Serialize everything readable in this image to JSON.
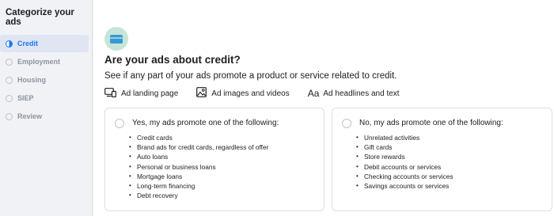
{
  "sidebar": {
    "title": "Categorize your ads",
    "steps": [
      {
        "label": "Credit",
        "active": true
      },
      {
        "label": "Employment",
        "active": false
      },
      {
        "label": "Housing",
        "active": false
      },
      {
        "label": "SIEP",
        "active": false
      },
      {
        "label": "Review",
        "active": false
      }
    ]
  },
  "main": {
    "icon": "credit-card-icon",
    "heading": "Are your ads about credit?",
    "subtext": "See if any part of your ads promote a product or service related to credit.",
    "features": [
      {
        "icon": "devices-icon",
        "label": "Ad landing page"
      },
      {
        "icon": "image-icon",
        "label": "Ad images and videos"
      },
      {
        "icon": "text-aa-icon",
        "glyph": "Aa",
        "label": "Ad headlines and text"
      }
    ]
  },
  "options": {
    "yes": {
      "title": "Yes, my ads promote one of the following:",
      "items": [
        "Credit cards",
        "Brand ads for credit cards, regardless of offer",
        "Auto loans",
        "Personal or business loans",
        "Mortgage loans",
        "Long-term financing",
        "Debt recovery"
      ]
    },
    "no": {
      "title": "No, my ads promote one of the following:",
      "items": [
        "Unrelated activities",
        "Gift cards",
        "Store rewards",
        "Debit accounts or services",
        "Checking accounts or services",
        "Savings accounts or services"
      ]
    }
  },
  "colors": {
    "accent": "#1877f2",
    "sidebar_bg": "#f0f2f5",
    "active_step_bg": "#dfe5f2",
    "inactive_text": "#8d949e"
  }
}
